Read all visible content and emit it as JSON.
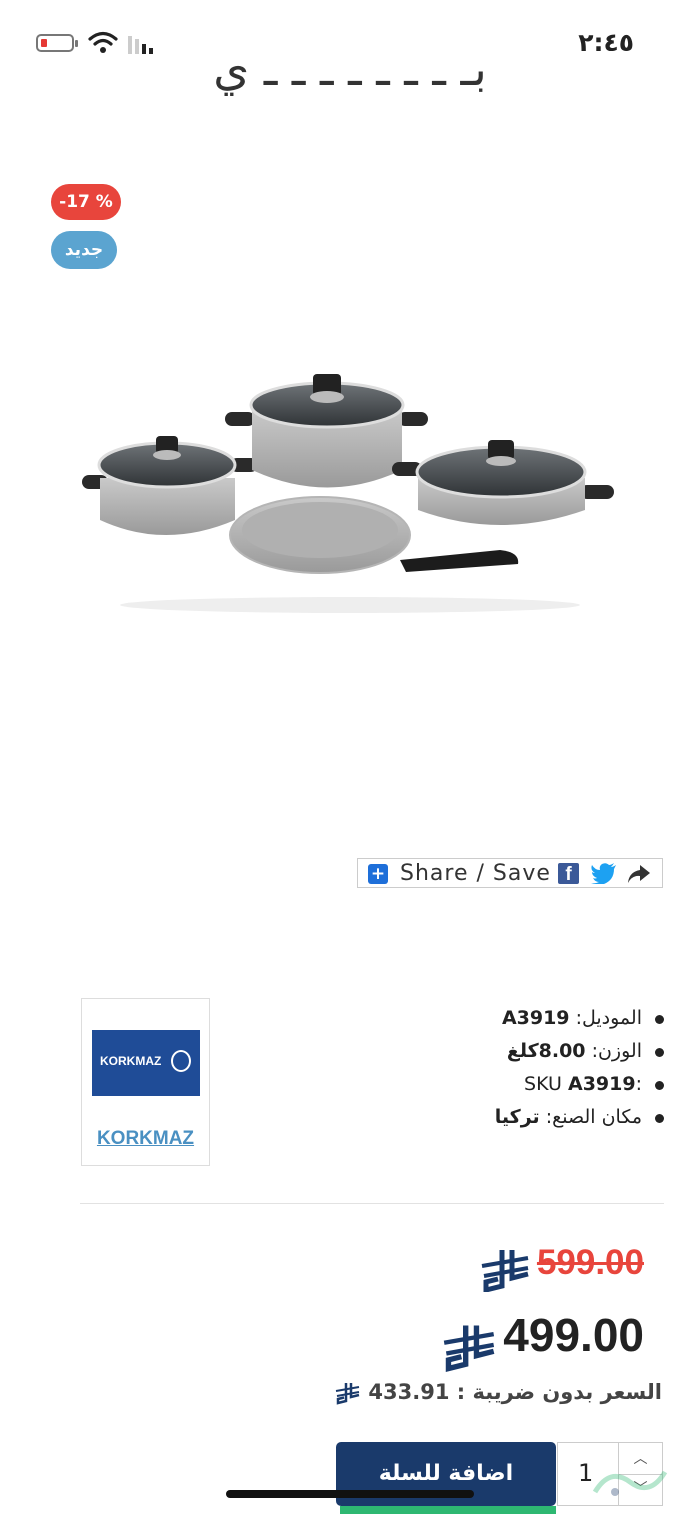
{
  "status_bar": {
    "time": "٢:٤٥"
  },
  "product": {
    "title_fragment": "بـ ـ ـ ـ ـ ـ ـ ـ ي",
    "badges": {
      "discount": "-17 %",
      "new": "جديد"
    }
  },
  "share": {
    "label": "Share / Save"
  },
  "brand": {
    "name": "KORKMAZ",
    "logo_text": "KORKMAZ"
  },
  "specs": [
    {
      "label": "الموديل:",
      "value": "A3919"
    },
    {
      "label": "الوزن:",
      "value": "8.00كلغ"
    },
    {
      "label": ":SKU",
      "value": "A3919"
    },
    {
      "label": "مكان الصنع:",
      "value": "تركيا"
    }
  ],
  "pricing": {
    "old_price": "599.00",
    "new_price": "499.00",
    "no_tax_label": "السعر بدون ضريبة :",
    "no_tax_amount": "433.91"
  },
  "cart": {
    "add_label": "اضافة للسلة",
    "quantity": "1"
  },
  "colors": {
    "discount_badge": "#e8453c",
    "new_badge": "#5ba4d0",
    "cart_button": "#1a3a6b",
    "brand_blue": "#1f4c97"
  }
}
